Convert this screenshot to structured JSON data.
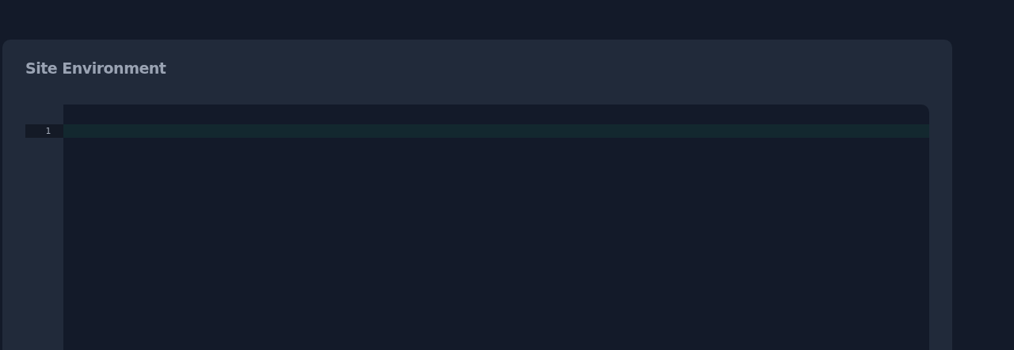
{
  "card": {
    "title": "Site Environment"
  },
  "editor": {
    "lines": [
      {
        "number": "1",
        "active": true
      }
    ]
  }
}
